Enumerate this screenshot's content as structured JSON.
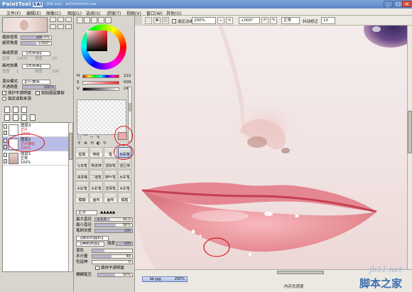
{
  "app": {
    "logo": "PaintTool",
    "logo_mark": "SAI",
    "title": "- [bb.sai] - ashshshshm.sai",
    "minimize": "_",
    "maximize": "□",
    "close": "×"
  },
  "menu": [
    "文件(F)",
    "编辑(E)",
    "图像(C)",
    "图层(L)",
    "选择(S)",
    "滤镜(T)",
    "视图(V)",
    "窗口(W)",
    "其他(O)"
  ],
  "toolbar": {
    "selection_edge_label": "选区边缘",
    "zoom_value": "200%",
    "rotation_value": "+000°",
    "blend_mode_value": "正常",
    "stabilizer_label": "抖动修正",
    "stabilizer_value": "10"
  },
  "navigator": {
    "zoom_label": "缩放倍率",
    "zoom_value": "200.0%",
    "rotate_label": "旋转角度",
    "rotate_value": "+000°"
  },
  "texture": {
    "label": "画纸质感",
    "value": "【无质感】",
    "scale_label": "倍率",
    "scale_value": "100%",
    "intensity_label": "强度",
    "intensity_value": "20"
  },
  "effect": {
    "label": "画材效果",
    "value": "【无效果】",
    "width_label": "宽度",
    "width_value": "1",
    "intensity_label": "强度",
    "intensity_value": "100"
  },
  "blend": {
    "mode_label": "混合模式",
    "mode_value": "正片叠底",
    "opacity_label": "不透明度",
    "opacity_value": "100%"
  },
  "options": {
    "protect_opacity": "保护不透明度",
    "clip_layer": "剪贴图层蒙板",
    "specify_source": "指定选取来源"
  },
  "layers": [
    {
      "name": "图层3",
      "mode": "正片",
      "opacity": "100%",
      "selected": false
    },
    {
      "name": "图层2",
      "mode": "正片叠底",
      "opacity": "100%",
      "selected": true
    },
    {
      "name": "图层1",
      "mode": "正常",
      "opacity": "100%",
      "selected": false
    }
  ],
  "color": {
    "s_label": "S",
    "h_label": "H",
    "v_label": "V",
    "h_value": "222",
    "s_value": "009",
    "v_value": "244",
    "current": "#f0a8aa",
    "fg_hue": "#ff2a2a"
  },
  "tools_row": [
    "⬚",
    "⌒",
    "⌐",
    "✎",
    "↔",
    "✛",
    "⊕",
    "⟲",
    "↺",
    "◐",
    "↻"
  ],
  "brushes": [
    [
      "铅笔",
      "喷枪",
      "笔",
      "水彩笔"
    ],
    [
      "马克笔",
      "橡皮擦",
      "选取笔",
      "选区擦"
    ],
    [
      "油漆桶",
      "二值笔",
      "柳叶笔",
      "水彩笔"
    ],
    [
      "水彩笔",
      "水彩笔",
      "选择笔",
      "水彩笔"
    ],
    [
      "模糊",
      "画布",
      "画布",
      "橘笔"
    ]
  ],
  "brush_params": {
    "mode_value": "正常",
    "max_size_label": "最大直径",
    "max_size_mult": "x 1.0",
    "max_size_value": "40.0",
    "min_size_label": "最小直径",
    "min_size_value": "56%",
    "density_label": "笔刷浓度",
    "density_value": "100",
    "shape_label": "【通常的圆形】",
    "texture_label": "【画纸质感】",
    "intensity_label": "强度",
    "intensity_value": "100",
    "blend_label": "混色",
    "blend_value": "",
    "water_label": "水分量",
    "water_value": "48",
    "keep_color_label": "色延伸",
    "keep_color_value": "0",
    "keep_opacity_label": "维持不透明度",
    "blur_label": "模糊笔压",
    "blur_value": "50%"
  },
  "status": {
    "doc_name": "bb.jpg",
    "doc_zoom": "200%",
    "memory": "内存负荷度"
  },
  "watermark": {
    "url": "jb51.net",
    "name": "脚本之家"
  }
}
